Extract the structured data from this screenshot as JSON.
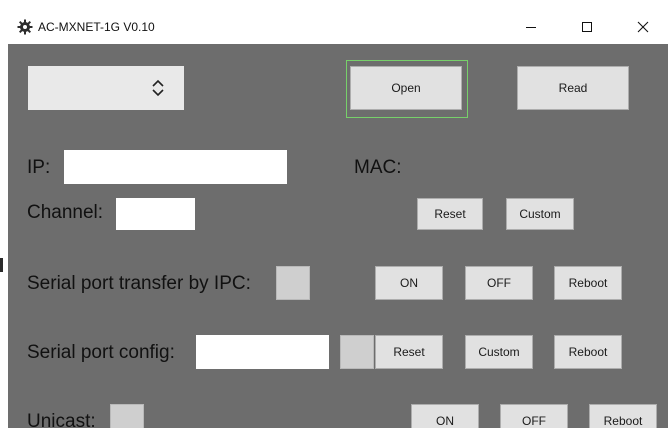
{
  "window": {
    "title": "AC-MXNET-1G V0.10",
    "controls": {
      "minimize_icon": "minimize-icon",
      "maximize_icon": "maximize-icon",
      "close_icon": "close-icon"
    }
  },
  "toolbar": {
    "port_select": {
      "value": "",
      "icon": "up-down-chevron-icon"
    },
    "open_label": "Open",
    "read_label": "Read"
  },
  "network": {
    "ip_label": "IP:",
    "ip_value": "",
    "mac_label": "MAC:",
    "mac_value": "",
    "channel_label": "Channel:",
    "channel_value": "",
    "reset_label": "Reset",
    "custom_label": "Custom"
  },
  "serial_transfer": {
    "label": "Serial port transfer by IPC:",
    "on_label": "ON",
    "off_label": "OFF",
    "reboot_label": "Reboot"
  },
  "serial_config": {
    "label": "Serial port config:",
    "value": "",
    "reset_label": "Reset",
    "custom_label": "Custom",
    "reboot_label": "Reboot"
  },
  "unicast": {
    "label": "Unicast:",
    "on_label": "ON",
    "off_label": "OFF",
    "reboot_label": "Reboot"
  },
  "colors": {
    "client_background": "#6d6d6d",
    "button_face": "#e1e1e1",
    "focus_ring": "#77d06a"
  }
}
